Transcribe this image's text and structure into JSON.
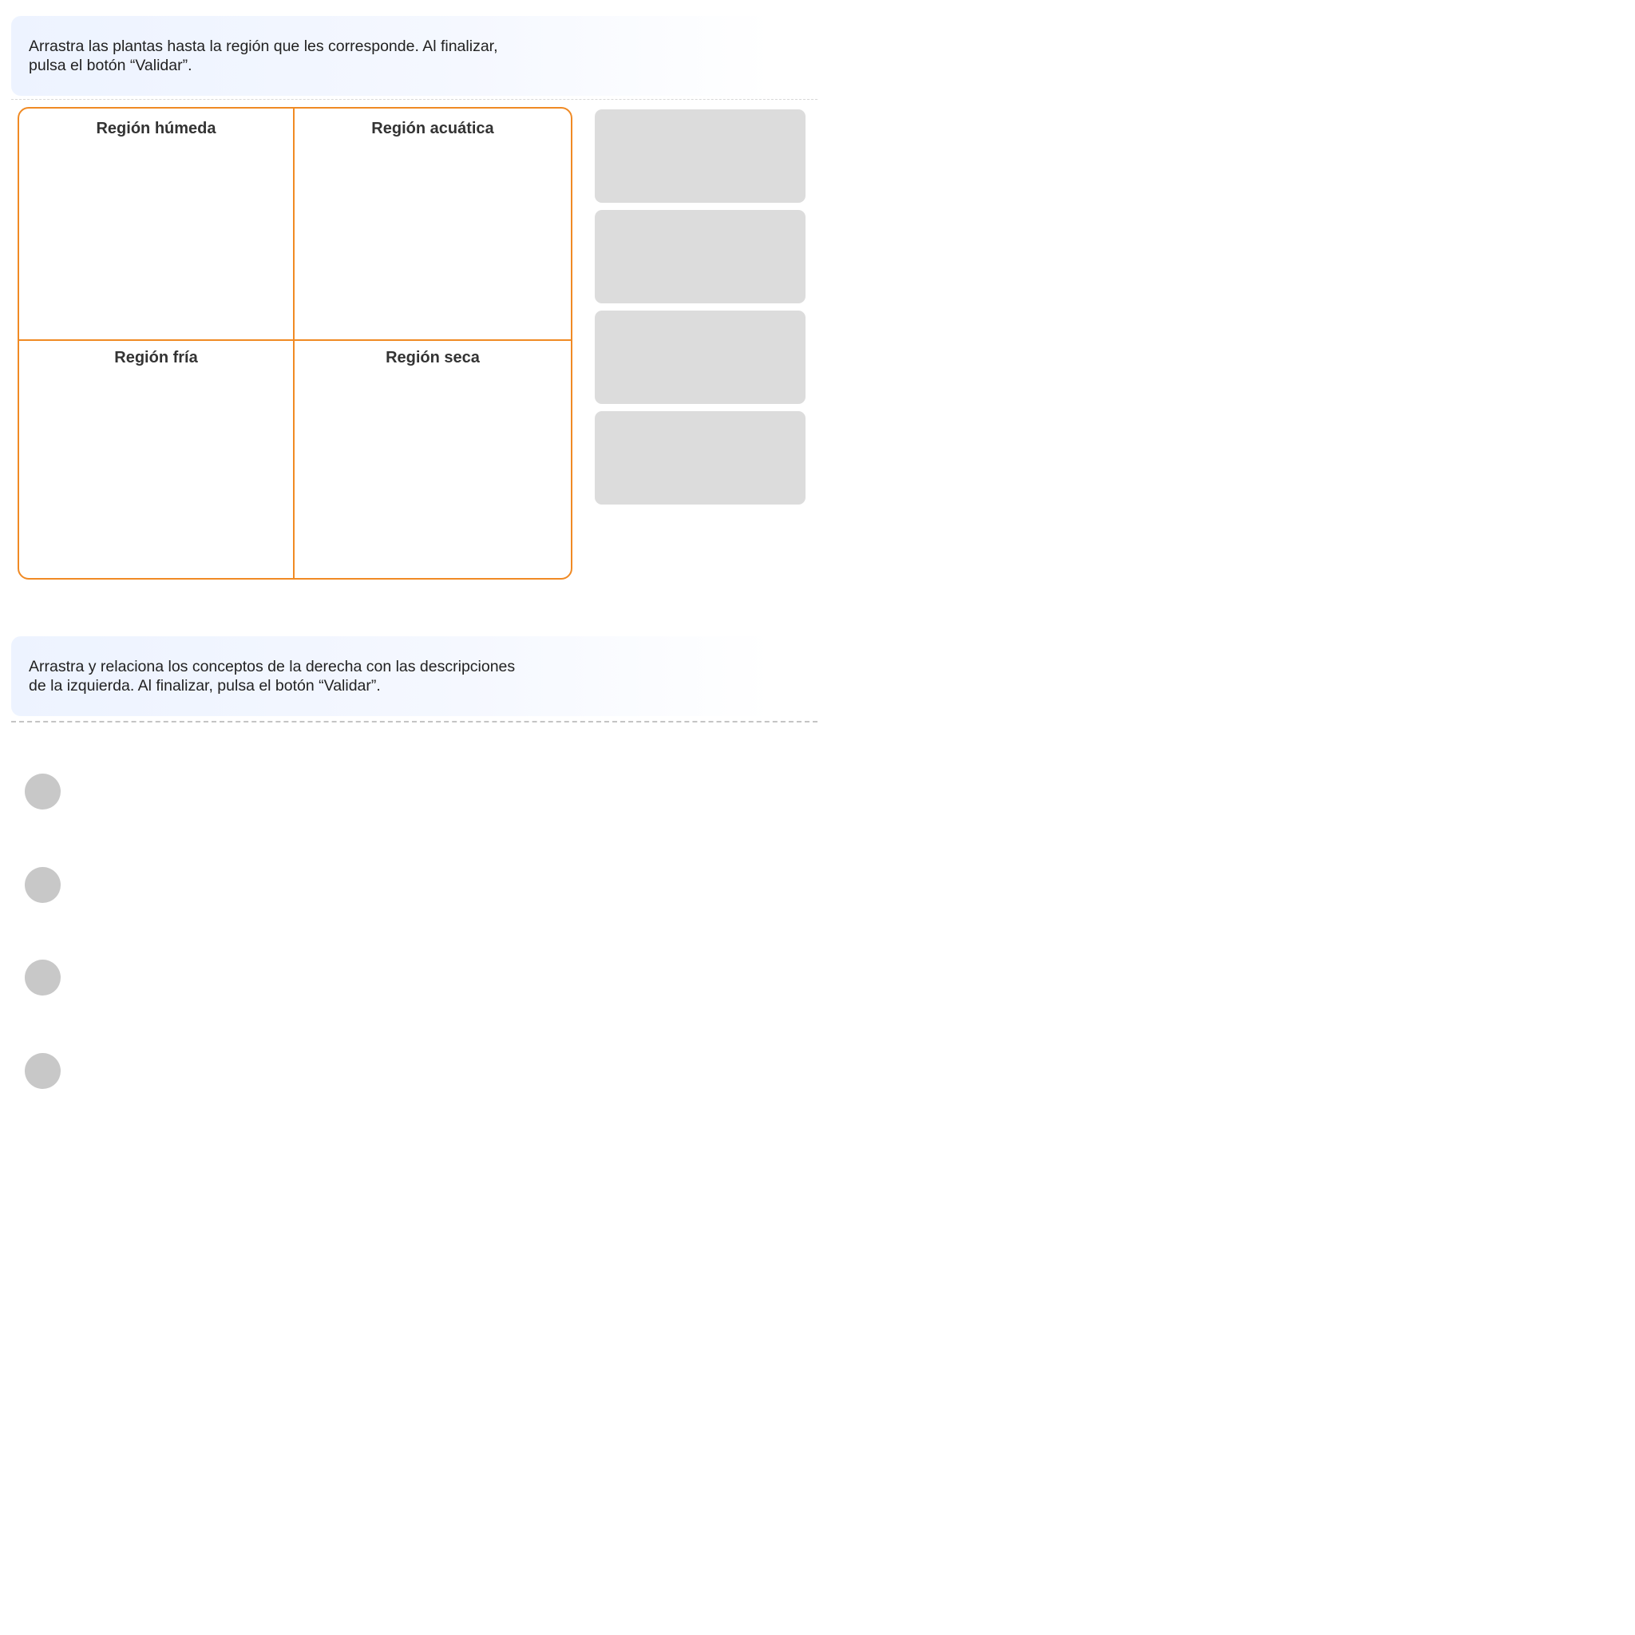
{
  "activity1": {
    "instruction_line1": "Arrastra las plantas hasta la región que les corresponde. Al finalizar,",
    "instruction_line2": "pulsa el botón “Validar”.",
    "regions": [
      {
        "label": "Región húmeda"
      },
      {
        "label": "Región acuática"
      },
      {
        "label": "Región fría"
      },
      {
        "label": "Región seca"
      }
    ],
    "plant_slot_count": 4
  },
  "activity2": {
    "instruction_line1": "Arrastra y relaciona los conceptos de la derecha con las descripciones",
    "instruction_line2": "de la izquierda. Al finalizar, pulsa el botón “Validar”.",
    "match_dot_count": 4
  },
  "colors": {
    "grid_border": "#f08a24",
    "slot_fill": "#dcdcdc",
    "dot_fill": "#c8c8c8",
    "instruction_bg": "#edf3ff"
  }
}
